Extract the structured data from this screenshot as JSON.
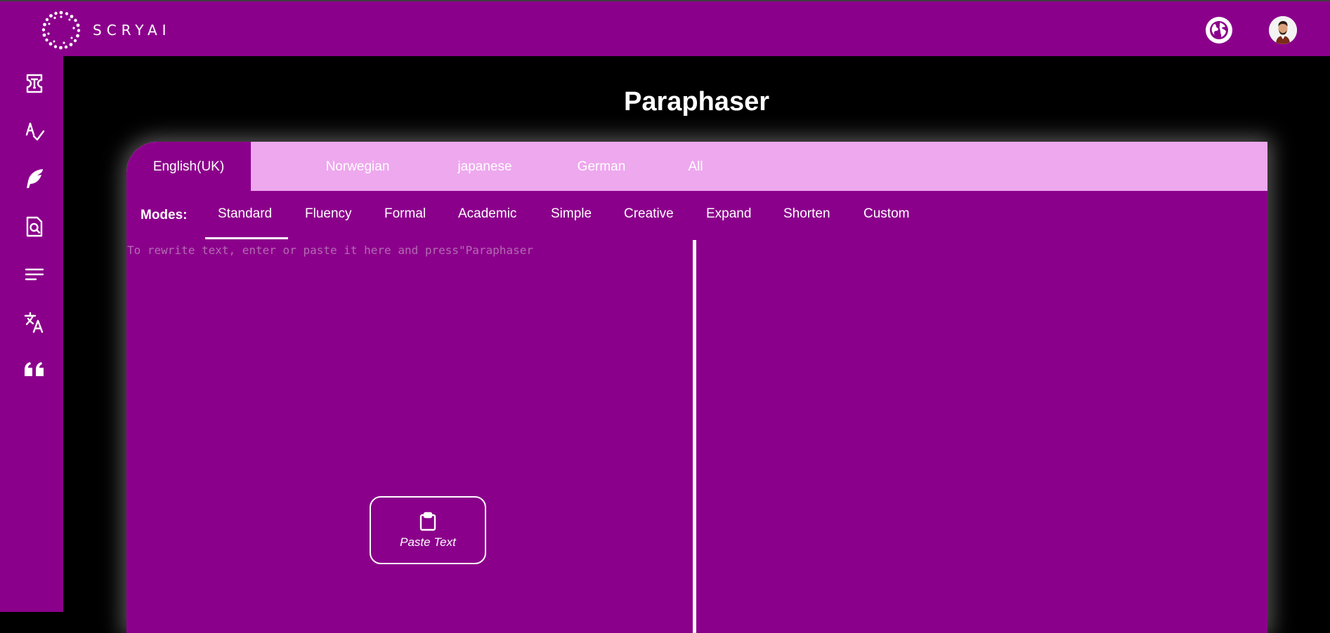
{
  "brand": {
    "name": "SCRYAI"
  },
  "header": {
    "globe_icon": "globe-icon",
    "avatar": "user-avatar"
  },
  "sidebar": {
    "items": [
      {
        "name": "text-tool",
        "icon": "text-frame-icon"
      },
      {
        "name": "grammar-checker",
        "icon": "spell-check-icon"
      },
      {
        "name": "writer",
        "icon": "feather-icon"
      },
      {
        "name": "plagiarism-checker",
        "icon": "document-search-icon"
      },
      {
        "name": "summarizer",
        "icon": "lines-icon"
      },
      {
        "name": "translator",
        "icon": "translate-icon"
      },
      {
        "name": "citation",
        "icon": "quote-icon"
      }
    ]
  },
  "page": {
    "title": "Paraphaser"
  },
  "languages": [
    "English(UK)",
    "Norwegian",
    "japanese",
    "German",
    "All"
  ],
  "active_language": "English(UK)",
  "modes": {
    "label": "Modes:",
    "items": [
      "Standard",
      "Fluency",
      "Formal",
      "Academic",
      "Simple",
      "Creative",
      "Expand",
      "Shorten",
      "Custom"
    ],
    "active": "Standard"
  },
  "editor": {
    "placeholder": "To rewrite text, enter or paste it here and press\"Paraphaser",
    "value": "",
    "paste_label": "Paste Text"
  },
  "colors": {
    "primary": "#8b008b",
    "tab_bar": "#eea8ee",
    "background": "#000000",
    "text": "#ffffff"
  }
}
